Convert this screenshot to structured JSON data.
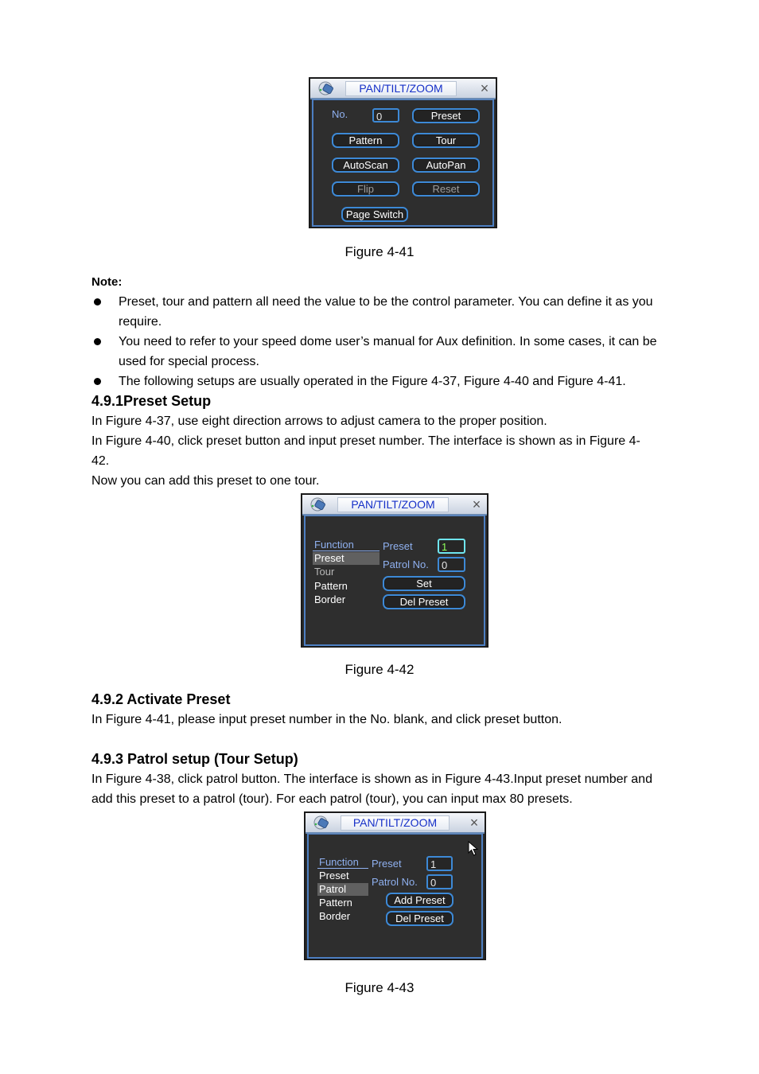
{
  "figures": [
    {
      "caption": "Figure 4-41",
      "dialog": {
        "title": "PAN/TILT/ZOOM",
        "no_label": "No.",
        "no_value": "0",
        "buttons": [
          {
            "label": "Preset",
            "enabled": true
          },
          {
            "label": "Pattern",
            "enabled": true
          },
          {
            "label": "Tour",
            "enabled": true
          },
          {
            "label": "AutoScan",
            "enabled": true
          },
          {
            "label": "AutoPan",
            "enabled": true
          },
          {
            "label": "Flip",
            "enabled": false
          },
          {
            "label": "Reset",
            "enabled": false
          },
          {
            "label": "Page Switch",
            "enabled": true
          }
        ]
      }
    },
    {
      "caption": "Figure 4-42",
      "dialog": {
        "title": "PAN/TILT/ZOOM",
        "menu_header": "Function",
        "menu": [
          "Preset",
          "Tour",
          "Pattern",
          "Border"
        ],
        "selected_menu": "Preset",
        "preset_label": "Preset",
        "preset_value": "1",
        "patrol_label": "Patrol No.",
        "patrol_value": "0",
        "buttons": [
          "Set",
          "Del Preset"
        ]
      }
    },
    {
      "caption": "Figure 4-43",
      "dialog": {
        "title": "PAN/TILT/ZOOM",
        "menu_header": "Function",
        "menu": [
          "Preset",
          "Patrol",
          "Pattern",
          "Border"
        ],
        "selected_menu": "Patrol",
        "preset_label": "Preset",
        "preset_value": "1",
        "patrol_label": "Patrol No.",
        "patrol_value": "0",
        "buttons": [
          "Add Preset",
          "Del Preset"
        ]
      }
    }
  ],
  "note": {
    "label": "Note:",
    "bullets": [
      "Preset, tour and pattern all need the value to be the control parameter. You can define it as you require.",
      "You need to refer to your speed dome user’s manual for Aux definition. In some cases, it can be used for special process.",
      "The following setups are usually operated in the Figure 4-37, Figure 4-40 and Figure 4-41."
    ]
  },
  "sections": [
    {
      "heading": "4.9.1Preset Setup",
      "paragraphs": [
        "In Figure 4-37, use eight direction arrows to adjust camera to the proper position.",
        "In Figure 4-40, click preset button and input preset number. The interface is shown as in Figure 4-42.",
        "Now you can add this preset to one tour."
      ]
    },
    {
      "heading": "4.9.2 Activate Preset",
      "paragraphs": [
        "In Figure 4-41, please input preset number in the No. blank, and click preset button."
      ]
    },
    {
      "heading": "4.9.3 Patrol setup (Tour Setup)",
      "paragraphs": [
        "In Figure 4-38, click patrol button. The interface is shown as in Figure 4-43.Input preset number and add this preset to a patrol (tour). For each patrol (tour), you can input max 80 presets."
      ]
    }
  ]
}
